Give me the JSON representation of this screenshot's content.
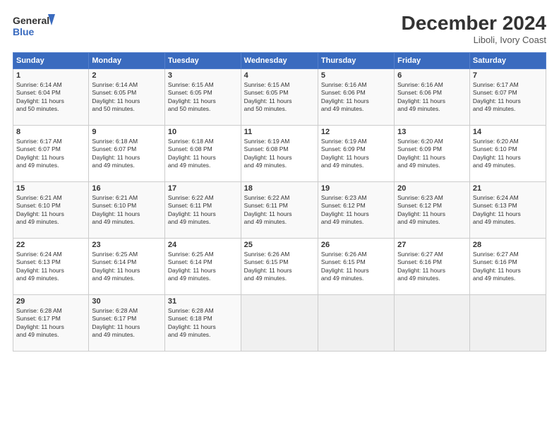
{
  "app": {
    "logo_line1": "General",
    "logo_line2": "Blue"
  },
  "title": "December 2024",
  "subtitle": "Liboli, Ivory Coast",
  "days_header": [
    "Sunday",
    "Monday",
    "Tuesday",
    "Wednesday",
    "Thursday",
    "Friday",
    "Saturday"
  ],
  "weeks": [
    [
      {
        "day": "1",
        "info": "Sunrise: 6:14 AM\nSunset: 6:04 PM\nDaylight: 11 hours\nand 50 minutes."
      },
      {
        "day": "2",
        "info": "Sunrise: 6:14 AM\nSunset: 6:05 PM\nDaylight: 11 hours\nand 50 minutes."
      },
      {
        "day": "3",
        "info": "Sunrise: 6:15 AM\nSunset: 6:05 PM\nDaylight: 11 hours\nand 50 minutes."
      },
      {
        "day": "4",
        "info": "Sunrise: 6:15 AM\nSunset: 6:05 PM\nDaylight: 11 hours\nand 50 minutes."
      },
      {
        "day": "5",
        "info": "Sunrise: 6:16 AM\nSunset: 6:06 PM\nDaylight: 11 hours\nand 49 minutes."
      },
      {
        "day": "6",
        "info": "Sunrise: 6:16 AM\nSunset: 6:06 PM\nDaylight: 11 hours\nand 49 minutes."
      },
      {
        "day": "7",
        "info": "Sunrise: 6:17 AM\nSunset: 6:07 PM\nDaylight: 11 hours\nand 49 minutes."
      }
    ],
    [
      {
        "day": "8",
        "info": "Sunrise: 6:17 AM\nSunset: 6:07 PM\nDaylight: 11 hours\nand 49 minutes."
      },
      {
        "day": "9",
        "info": "Sunrise: 6:18 AM\nSunset: 6:07 PM\nDaylight: 11 hours\nand 49 minutes."
      },
      {
        "day": "10",
        "info": "Sunrise: 6:18 AM\nSunset: 6:08 PM\nDaylight: 11 hours\nand 49 minutes."
      },
      {
        "day": "11",
        "info": "Sunrise: 6:19 AM\nSunset: 6:08 PM\nDaylight: 11 hours\nand 49 minutes."
      },
      {
        "day": "12",
        "info": "Sunrise: 6:19 AM\nSunset: 6:09 PM\nDaylight: 11 hours\nand 49 minutes."
      },
      {
        "day": "13",
        "info": "Sunrise: 6:20 AM\nSunset: 6:09 PM\nDaylight: 11 hours\nand 49 minutes."
      },
      {
        "day": "14",
        "info": "Sunrise: 6:20 AM\nSunset: 6:10 PM\nDaylight: 11 hours\nand 49 minutes."
      }
    ],
    [
      {
        "day": "15",
        "info": "Sunrise: 6:21 AM\nSunset: 6:10 PM\nDaylight: 11 hours\nand 49 minutes."
      },
      {
        "day": "16",
        "info": "Sunrise: 6:21 AM\nSunset: 6:10 PM\nDaylight: 11 hours\nand 49 minutes."
      },
      {
        "day": "17",
        "info": "Sunrise: 6:22 AM\nSunset: 6:11 PM\nDaylight: 11 hours\nand 49 minutes."
      },
      {
        "day": "18",
        "info": "Sunrise: 6:22 AM\nSunset: 6:11 PM\nDaylight: 11 hours\nand 49 minutes."
      },
      {
        "day": "19",
        "info": "Sunrise: 6:23 AM\nSunset: 6:12 PM\nDaylight: 11 hours\nand 49 minutes."
      },
      {
        "day": "20",
        "info": "Sunrise: 6:23 AM\nSunset: 6:12 PM\nDaylight: 11 hours\nand 49 minutes."
      },
      {
        "day": "21",
        "info": "Sunrise: 6:24 AM\nSunset: 6:13 PM\nDaylight: 11 hours\nand 49 minutes."
      }
    ],
    [
      {
        "day": "22",
        "info": "Sunrise: 6:24 AM\nSunset: 6:13 PM\nDaylight: 11 hours\nand 49 minutes."
      },
      {
        "day": "23",
        "info": "Sunrise: 6:25 AM\nSunset: 6:14 PM\nDaylight: 11 hours\nand 49 minutes."
      },
      {
        "day": "24",
        "info": "Sunrise: 6:25 AM\nSunset: 6:14 PM\nDaylight: 11 hours\nand 49 minutes."
      },
      {
        "day": "25",
        "info": "Sunrise: 6:26 AM\nSunset: 6:15 PM\nDaylight: 11 hours\nand 49 minutes."
      },
      {
        "day": "26",
        "info": "Sunrise: 6:26 AM\nSunset: 6:15 PM\nDaylight: 11 hours\nand 49 minutes."
      },
      {
        "day": "27",
        "info": "Sunrise: 6:27 AM\nSunset: 6:16 PM\nDaylight: 11 hours\nand 49 minutes."
      },
      {
        "day": "28",
        "info": "Sunrise: 6:27 AM\nSunset: 6:16 PM\nDaylight: 11 hours\nand 49 minutes."
      }
    ],
    [
      {
        "day": "29",
        "info": "Sunrise: 6:28 AM\nSunset: 6:17 PM\nDaylight: 11 hours\nand 49 minutes."
      },
      {
        "day": "30",
        "info": "Sunrise: 6:28 AM\nSunset: 6:17 PM\nDaylight: 11 hours\nand 49 minutes."
      },
      {
        "day": "31",
        "info": "Sunrise: 6:28 AM\nSunset: 6:18 PM\nDaylight: 11 hours\nand 49 minutes."
      },
      null,
      null,
      null,
      null
    ]
  ]
}
